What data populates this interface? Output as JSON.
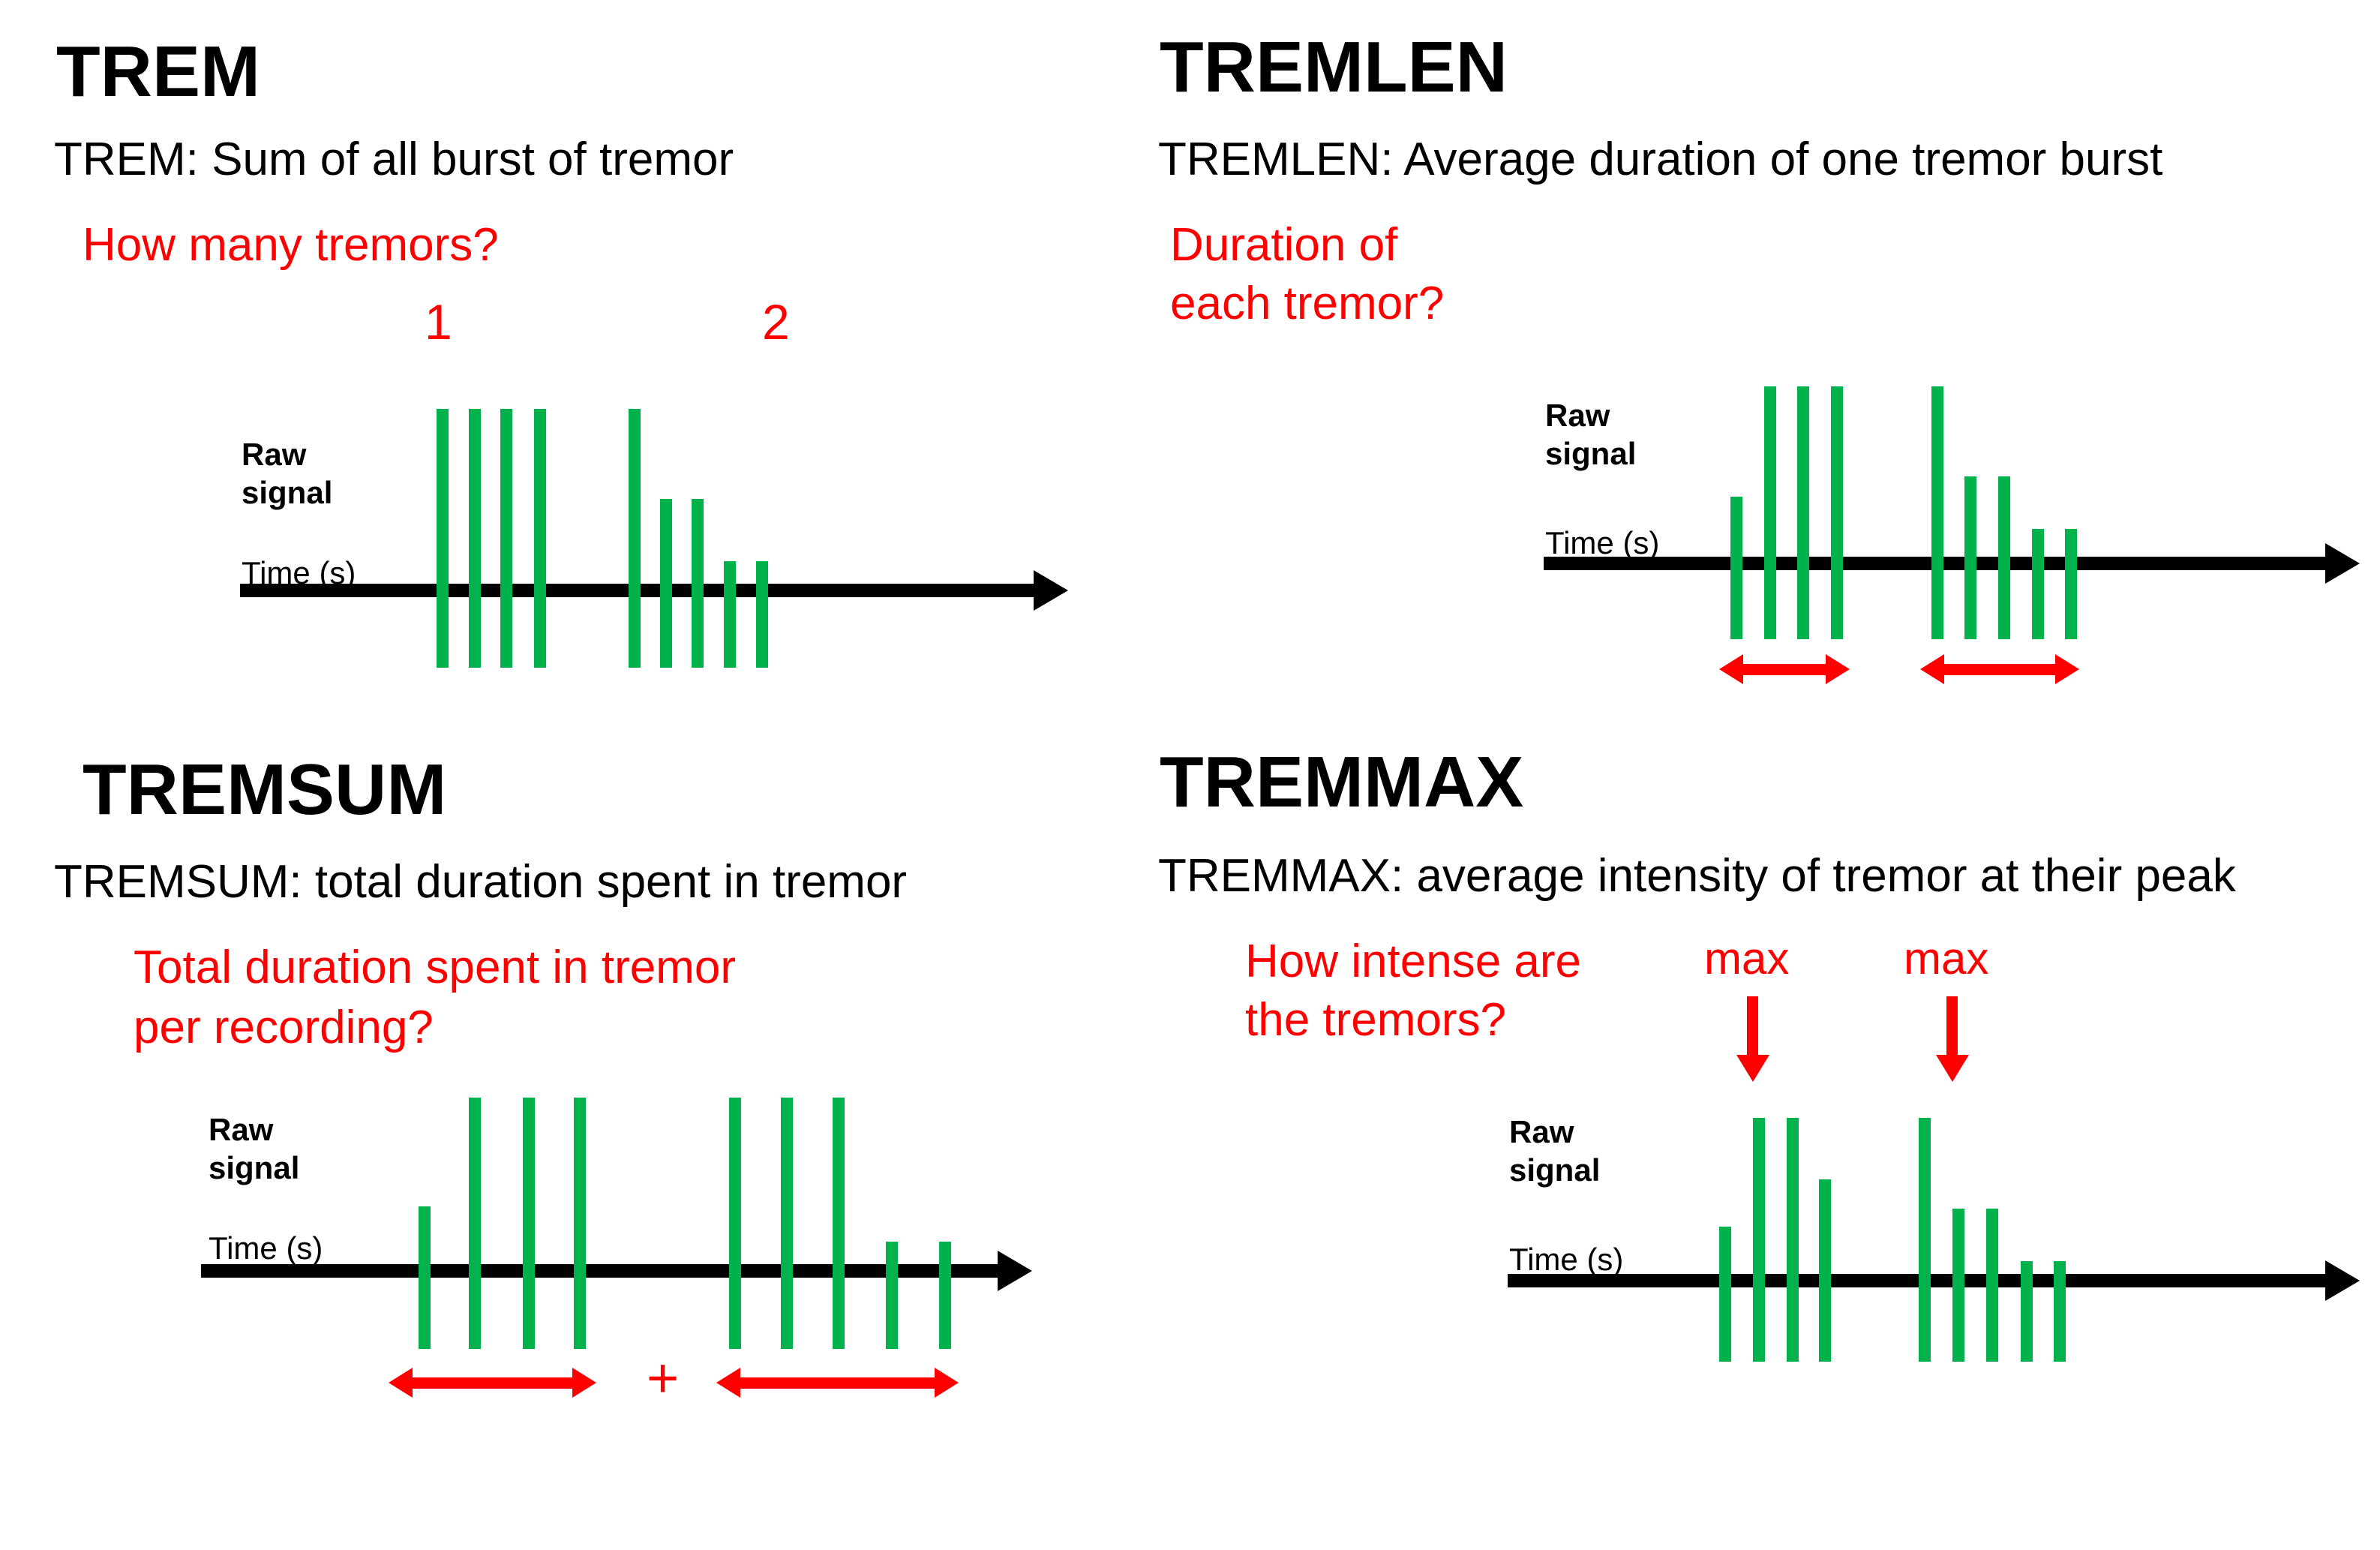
{
  "figure": {
    "colors": {
      "signal_green": "#00B24C",
      "annotation_red": "#FF0000",
      "axis_black": "#000000",
      "background": "#FFFFFF"
    }
  },
  "panels": [
    {
      "id": "trem",
      "title": "TREM",
      "definition": "TREM: Sum of all burst of tremor",
      "question_lines": [
        "How many tremors?"
      ],
      "axis_label_y": "Raw\nsignal",
      "axis_label_x": "Time (s)",
      "burst_counters": [
        "1",
        "2"
      ],
      "chart_data": {
        "type": "bar",
        "title": "TREM",
        "xlabel": "Time (s)",
        "ylabel": "Raw signal",
        "description": "Raw tremor signal: two bursts of spikes on a time axis; bursts are counted 1 and 2",
        "baseline_value": 0,
        "grid": false,
        "legend": false,
        "series": [
          {
            "name": "Raw signal spikes",
            "burst": 1,
            "x": [
              582,
              625,
              667,
              712
            ],
            "amplitude": [
              1.0,
              1.0,
              1.0,
              1.0
            ]
          },
          {
            "name": "Raw signal spikes",
            "burst": 2,
            "x": [
              838,
              880,
              922,
              965,
              1008
            ],
            "amplitude": [
              1.0,
              0.64,
              0.64,
              0.36,
              0.36
            ]
          }
        ]
      }
    },
    {
      "id": "tremlen",
      "title": "TREMLEN",
      "definition": "TREMLEN: Average duration of one tremor burst",
      "question_lines": [
        "Duration of",
        "each tremor?"
      ],
      "axis_label_y": "Raw\nsignal",
      "axis_label_x": "Time (s)",
      "annotation": "double-headed red arrow spanning each burst",
      "chart_data": {
        "type": "bar",
        "title": "TREMLEN",
        "xlabel": "Time (s)",
        "ylabel": "Raw signal",
        "description": "Two bursts with red double-headed arrows measuring the duration of each burst",
        "baseline_value": 0,
        "grid": false,
        "legend": false,
        "series": [
          {
            "name": "Raw signal spikes",
            "burst": 1,
            "x": [
              2307,
              2352,
              2396,
              2441
            ],
            "amplitude": [
              0.46,
              1.0,
              1.0,
              1.0
            ]
          },
          {
            "name": "Raw signal spikes",
            "burst": 2,
            "x": [
              2575,
              2619,
              2664,
              2709,
              2753
            ],
            "amplitude": [
              1.0,
              0.62,
              0.62,
              0.36,
              0.36
            ]
          }
        ],
        "annotations": [
          {
            "type": "double-arrow",
            "label": "",
            "x_start": 2292,
            "x_end": 2466
          },
          {
            "type": "double-arrow",
            "label": "",
            "x_start": 2560,
            "x_end": 2772
          }
        ]
      }
    },
    {
      "id": "tremsum",
      "title": "TREMSUM",
      "definition": "TREMSUM: total duration spent in tremor",
      "question_lines": [
        "Total duration spent in tremor",
        "per recording?"
      ],
      "axis_label_y": "Raw\nsignal",
      "axis_label_x": "Time (s)",
      "operator": "+",
      "chart_data": {
        "type": "bar",
        "title": "TREMSUM",
        "xlabel": "Time (s)",
        "ylabel": "Raw signal",
        "description": "Two bursts; durations of both bursts are added together (arrow + arrow)",
        "baseline_value": 0,
        "grid": false,
        "legend": false,
        "series": [
          {
            "name": "Raw signal spikes",
            "burst": 1,
            "x": [
              558,
              625,
              697,
              765
            ],
            "amplitude": [
              0.49,
              1.0,
              1.0,
              1.0
            ]
          },
          {
            "name": "Raw signal spikes",
            "burst": 2,
            "x": [
              972,
              1041,
              1110,
              1181,
              1252
            ],
            "amplitude": [
              1.0,
              1.0,
              1.0,
              0.35,
              0.35
            ]
          }
        ],
        "annotations": [
          {
            "type": "double-arrow",
            "label": "",
            "x_start": 518,
            "x_end": 795
          },
          {
            "type": "text",
            "label": "+",
            "x": 882
          },
          {
            "type": "double-arrow",
            "label": "",
            "x_start": 955,
            "x_end": 1278
          }
        ]
      }
    },
    {
      "id": "tremmax",
      "title": "TREMMAX",
      "definition": "TREMMAX: average intensity of tremor at their peak",
      "question_lines": [
        "How intense are",
        "the tremors?"
      ],
      "axis_label_y": "Raw\nsignal",
      "axis_label_x": "Time (s)",
      "peak_labels": [
        "max",
        "max"
      ],
      "chart_data": {
        "type": "bar",
        "title": "TREMMAX",
        "xlabel": "Time (s)",
        "ylabel": "Raw signal",
        "description": "Two bursts; red 'max' arrows point at the tallest spike of each burst",
        "baseline_value": 0,
        "grid": false,
        "legend": false,
        "series": [
          {
            "name": "Raw signal spikes",
            "burst": 1,
            "x": [
              2291,
              2337,
              2382,
              2425
            ],
            "amplitude": [
              0.38,
              1.0,
              1.0,
              0.73
            ]
          },
          {
            "name": "Raw signal spikes",
            "burst": 2,
            "x": [
              2558,
              2603,
              2648,
              2694,
              2738
            ],
            "amplitude": [
              1.0,
              0.52,
              0.52,
              0.23,
              0.23
            ]
          }
        ],
        "annotations": [
          {
            "type": "down-arrow",
            "label": "max",
            "x": 2337
          },
          {
            "type": "down-arrow",
            "label": "max",
            "x": 2603
          }
        ]
      }
    }
  ]
}
